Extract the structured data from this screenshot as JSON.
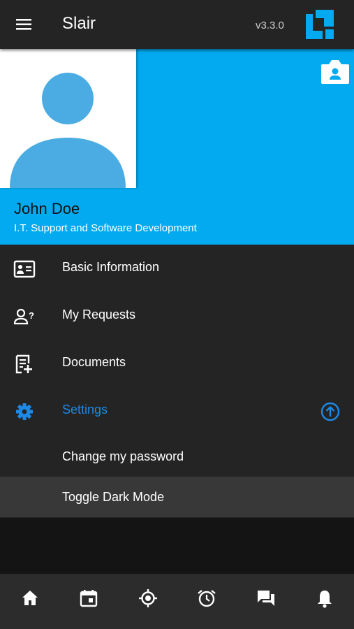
{
  "appbar": {
    "title": "Slair",
    "version": "v3.3.0",
    "menu_icon": "hamburger-menu-icon",
    "logo": "slair-logo",
    "accent": "#03aaf0"
  },
  "profile": {
    "name": "John Doe",
    "role": "I.T. Support and Software Development",
    "avatar_icon": "person-avatar-placeholder",
    "camera_icon": "camera-portrait-icon",
    "background": "#03aaf0"
  },
  "nav": {
    "items": [
      {
        "label": "Basic Information",
        "icon": "id-card-icon"
      },
      {
        "label": "My Requests",
        "icon": "person-question-icon"
      },
      {
        "label": "Documents",
        "icon": "document-add-icon"
      },
      {
        "label": "Settings",
        "icon": "gear-icon",
        "active": true,
        "expanded": true
      }
    ],
    "settings_subitems": [
      {
        "label": "Change my password"
      },
      {
        "label": "Toggle Dark Mode",
        "highlighted": true
      }
    ],
    "collapse_icon": "arrow-up-circle-icon",
    "active_color": "#1e88e5"
  },
  "bottom_tabs": [
    {
      "icon": "home-icon"
    },
    {
      "icon": "calendar-icon"
    },
    {
      "icon": "location-target-icon"
    },
    {
      "icon": "alarm-clock-icon"
    },
    {
      "icon": "chat-icon"
    },
    {
      "icon": "bell-icon"
    }
  ]
}
